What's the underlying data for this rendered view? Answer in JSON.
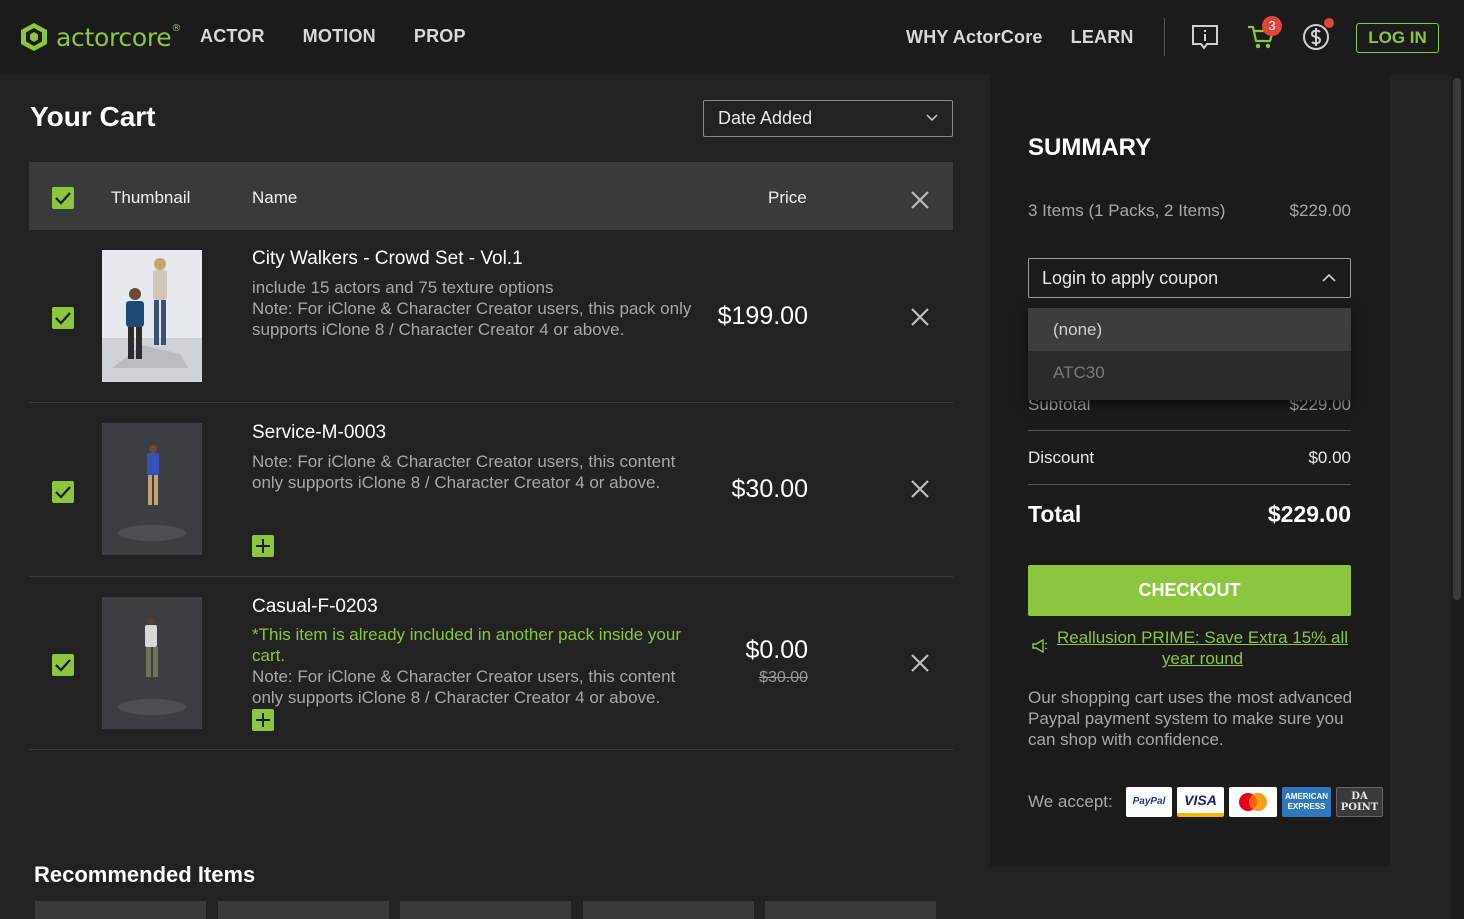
{
  "header": {
    "logo_text": "actorcore",
    "logo_reg": "®",
    "nav_left": [
      "ACTOR",
      "MOTION",
      "PROP"
    ],
    "nav_right": [
      "WHY ActorCore",
      "LEARN"
    ],
    "cart_count": "3",
    "login_label": "LOG IN"
  },
  "cart": {
    "title": "Your Cart",
    "sort_value": "Date Added",
    "columns": {
      "thumbnail": "Thumbnail",
      "name": "Name",
      "price": "Price"
    },
    "items": [
      {
        "name": "City Walkers - Crowd Set - Vol.1",
        "desc1": "include 15 actors and 75 texture options",
        "desc2": "Note: For iClone & Character Creator users, this pack only supports iClone 8 / Character Creator 4 or above.",
        "price": "$199.00"
      },
      {
        "name": "Service-M-0003",
        "desc1": "Note: For iClone & Character Creator users, this content only supports iClone 8 / Character Creator 4 or above.",
        "price": "$30.00"
      },
      {
        "name": "Casual-F-0203",
        "notice": "*This item is already included in another pack inside your cart.",
        "desc1": "Note: For iClone & Character Creator users, this content only supports iClone 8 / Character Creator 4 or above.",
        "price": "$0.00",
        "old_price": "$30.00"
      }
    ],
    "recommended_title": "Recommended Items"
  },
  "summary": {
    "title": "SUMMARY",
    "items_label": "3 Items (1 Packs, 2 Items)",
    "items_value": "$229.00",
    "coupon_placeholder": "Login to apply coupon",
    "coupon_options": [
      "(none)",
      "ATC30"
    ],
    "subtotal_label": "Subtotal",
    "subtotal_value": "$229.00",
    "discount_label": "Discount",
    "discount_value": "$0.00",
    "total_label": "Total",
    "total_value": "$229.00",
    "checkout_label": "CHECKOUT",
    "prime_link": "Reallusion PRIME: Save Extra 15% all year round",
    "confidence_text": "Our shopping cart uses the most advanced Paypal payment system to make sure you can shop with confidence.",
    "accept_label": "We accept:",
    "payment_methods": {
      "paypal": "PayPal",
      "visa": "VISA",
      "amex": "AMERICAN EXPRESS",
      "da1": "DA",
      "da2": "POINT"
    }
  },
  "colors": {
    "accent": "#8cc63f",
    "badge": "#e0443b",
    "background": "#222222",
    "panel": "#1b1b1b"
  }
}
